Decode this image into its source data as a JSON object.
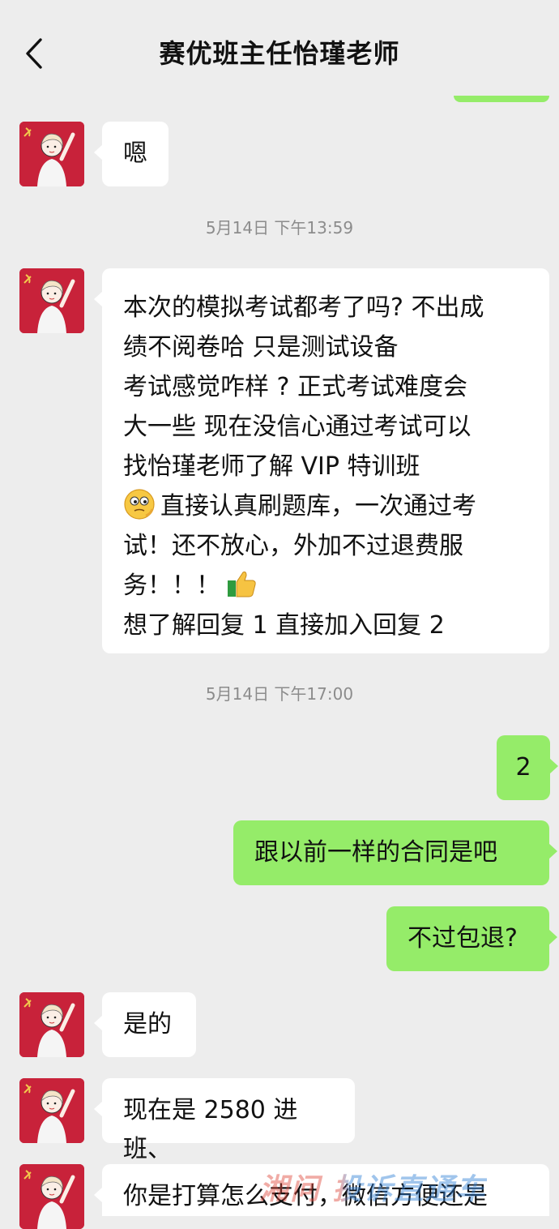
{
  "header": {
    "title": "赛优班主任怡瑾老师"
  },
  "messages": [
    {
      "text": "嗯"
    },
    {
      "timestamp": "5月14日 下午13:59"
    },
    {
      "lines": [
        "本次的模拟考试都考了吗? 不出成",
        "绩不阅卷哈 只是测试设备",
        "考试感觉咋样 ? 正式考试难度会",
        "大一些  现在没信心通过考试可以",
        "找怡瑾老师了解 VIP 特训班",
        "直接认真刷题库，一次通过考",
        "试！还不放心，外加不过退费服",
        "务！！！",
        "想了解回复 1  直接加入回复 2"
      ]
    },
    {
      "timestamp": "5月14日 下午17:00"
    },
    {
      "text": "2"
    },
    {
      "text": "跟以前一样的合同是吧"
    },
    {
      "text": "不过包退?"
    },
    {
      "text": "是的"
    },
    {
      "text": "现在是 2580 进班、"
    },
    {
      "text": "你是打算怎么支付，微信方便还是"
    }
  ],
  "watermark": "湘问 投诉直通车",
  "icons": {
    "back": "chevron-left-icon",
    "emoji1": "thinking-face-emoji-icon",
    "emoji2": "thumbs-up-emoji-icon",
    "avatar": "girl-avatar-icon"
  },
  "colors": {
    "background": "#ededed",
    "incoming_bubble": "#ffffff",
    "outgoing_bubble": "#95ec69",
    "avatar_bg": "#c8223a",
    "timestamp": "#8c8c8c"
  }
}
